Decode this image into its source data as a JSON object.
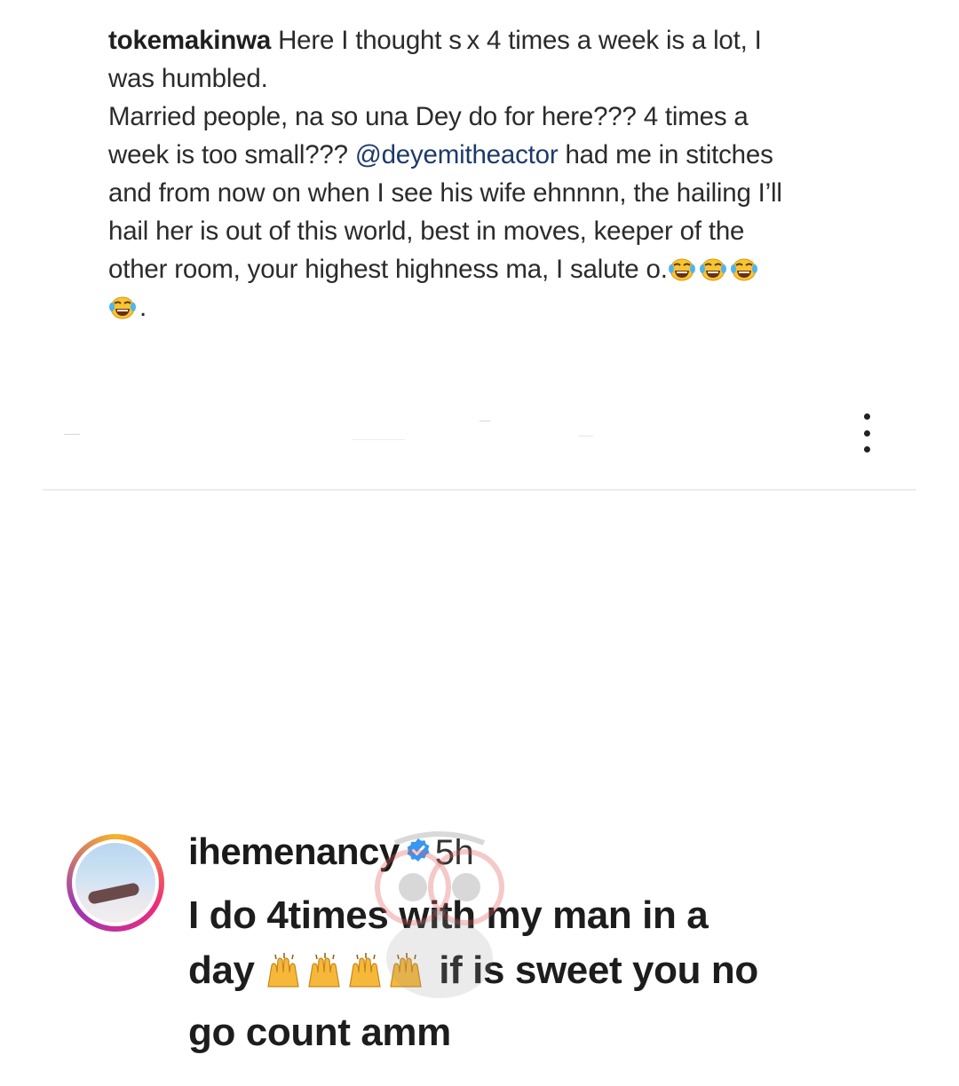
{
  "post": {
    "username": "tokemakinwa",
    "caption_lines": [
      "Here I thought s x 4 times a week is a lot, I",
      "was humbled.",
      "Married people, na so una Dey do for here??? 4 times a",
      "week is too small???",
      "had me in stitches",
      "and from now on when I see his wife ehnnnn, the hailing I’ll",
      "hail her is out of this world, best in moves, keeper of the",
      "other room, your highest highness ma, I salute o."
    ],
    "mention": "@deyemitheactor",
    "caption_end": ".",
    "emoji": "face-with-tears-of-joy-icon"
  },
  "comment": {
    "username": "ihemenancy",
    "time": "5h",
    "text_line1": "I do 4times with my man in a",
    "text_line2a": "day",
    "text_line2b": "if is sweet you no",
    "text_line3": "go count amm",
    "emoji": "raising-hands-icon"
  },
  "colors": {
    "mention": "#1e3a6b",
    "verified": "#3897f0",
    "avatar_ring": [
      "#f7b32b",
      "#ee2a7b",
      "#9b36b7"
    ],
    "watermark": "#e05a5a"
  }
}
